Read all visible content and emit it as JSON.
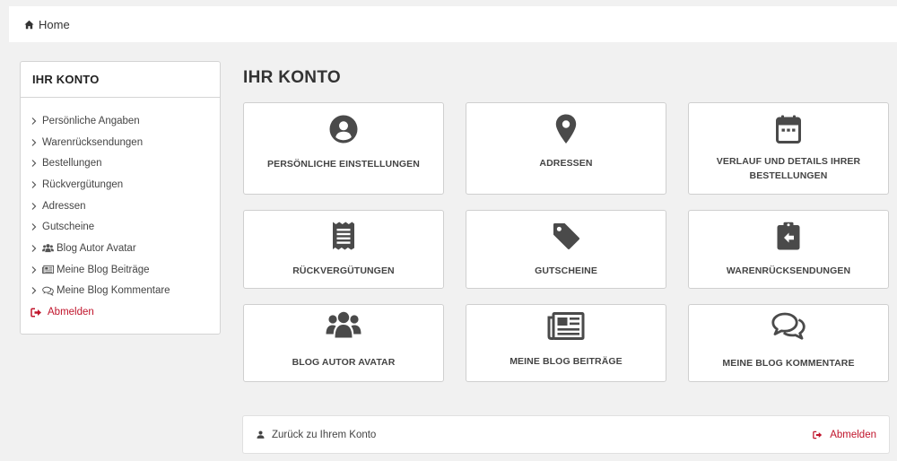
{
  "breadcrumb": {
    "home_label": "Home"
  },
  "sidebar": {
    "title": "IHR KONTO",
    "items": [
      {
        "label": "Persönliche Angaben"
      },
      {
        "label": "Warenrücksendungen"
      },
      {
        "label": "Bestellungen"
      },
      {
        "label": "Rückvergütungen"
      },
      {
        "label": "Adressen"
      },
      {
        "label": "Gutscheine"
      },
      {
        "label": "Blog Autor Avatar",
        "icon": "users-icon"
      },
      {
        "label": "Meine Blog Beiträge",
        "icon": "newspaper-icon"
      },
      {
        "label": "Meine Blog Kommentare",
        "icon": "comments-icon"
      }
    ],
    "logout_label": "Abmelden"
  },
  "main": {
    "title": "IHR KONTO",
    "tiles": [
      {
        "label": "PERSÖNLICHE EINSTELLUNGEN",
        "icon": "user-circle-icon"
      },
      {
        "label": "ADRESSEN",
        "icon": "map-marker-icon"
      },
      {
        "label": "VERLAUF UND DETAILS IHRER BESTELLUNGEN",
        "icon": "calendar-icon"
      },
      {
        "label": "RÜCKVERGÜTUNGEN",
        "icon": "receipt-icon"
      },
      {
        "label": "GUTSCHEINE",
        "icon": "tag-icon"
      },
      {
        "label": "WARENRÜCKSENDUNGEN",
        "icon": "clipboard-return-icon"
      },
      {
        "label": "BLOG AUTOR AVATAR",
        "icon": "users-icon"
      },
      {
        "label": "MEINE BLOG BEITRÄGE",
        "icon": "newspaper-icon"
      },
      {
        "label": "MEINE BLOG KOMMENTARE",
        "icon": "comments-icon"
      }
    ]
  },
  "footer": {
    "back_label": "Zurück zu Ihrem Konto",
    "logout_label": "Abmelden"
  },
  "colors": {
    "accent": "#c0142b",
    "icon": "#4a4a4a",
    "background": "#f1f1f1"
  }
}
